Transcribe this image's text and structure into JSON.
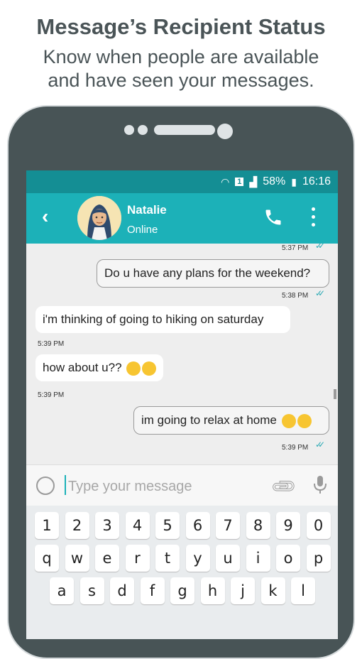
{
  "promo": {
    "title": "Message’s Recipient Status",
    "subtitle_line1": "Know when people are available",
    "subtitle_line2": "and have seen your messages."
  },
  "status_bar": {
    "battery": "58%",
    "time": "16:16",
    "sim": "1"
  },
  "header": {
    "contact_name": "Natalie",
    "contact_status": "Online"
  },
  "messages": [
    {
      "direction": "out",
      "text": "",
      "time": "5:37 PM",
      "read": true
    },
    {
      "direction": "out",
      "text": "Do u have any plans for the weekend?",
      "time": "5:38 PM",
      "read": true
    },
    {
      "direction": "in",
      "text": "i'm thinking of going to hiking on saturday",
      "time": "5:39 PM"
    },
    {
      "direction": "in",
      "text": "how about u??",
      "time": "5:39 PM",
      "emojis": [
        "winking-face",
        "winking-face"
      ]
    },
    {
      "direction": "out",
      "text": "im going to relax at home",
      "time": "5:39 PM",
      "read": true,
      "emojis": [
        "tears-of-joy",
        "tears-of-joy"
      ]
    }
  ],
  "composer": {
    "placeholder": "Type your message"
  },
  "keyboard": {
    "row1": [
      "1",
      "2",
      "3",
      "4",
      "5",
      "6",
      "7",
      "8",
      "9",
      "0"
    ],
    "row2": [
      "q",
      "w",
      "e",
      "r",
      "t",
      "y",
      "u",
      "i",
      "o",
      "p"
    ],
    "row3": [
      "a",
      "s",
      "d",
      "f",
      "g",
      "h",
      "j",
      "k",
      "l"
    ]
  },
  "colors": {
    "accent": "#1cb1b8",
    "status_bar": "#148e94",
    "read_tick": "#29a9b4",
    "phone_body": "#485456"
  }
}
